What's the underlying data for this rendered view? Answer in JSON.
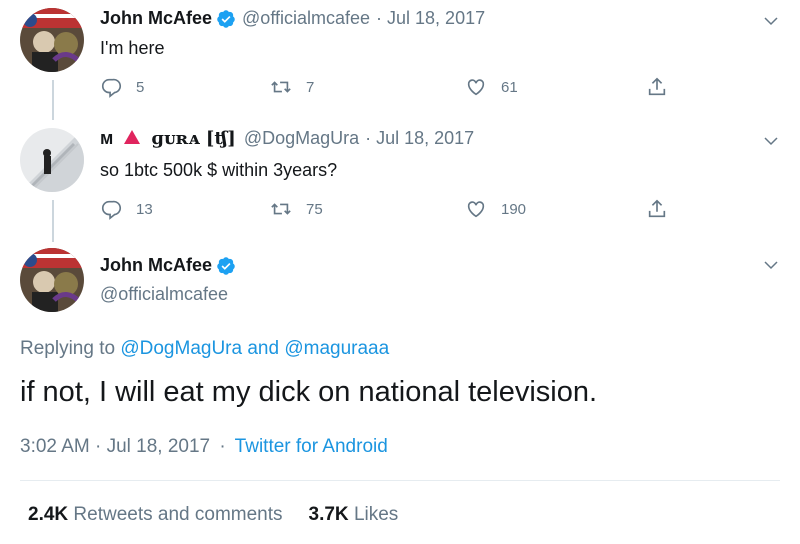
{
  "colors": {
    "text": "#14171a",
    "muted": "#657786",
    "link": "#1b95e0",
    "verified": "#1da1f2",
    "thread_line": "#ccd6dd"
  },
  "tweets": [
    {
      "name": "John McAfee",
      "verified": true,
      "handle": "@officialmcafee",
      "date": "· Jul 18, 2017",
      "text": "I'm here",
      "replies": "5",
      "retweets": "7",
      "likes": "61"
    },
    {
      "name_prefix": "ᴍ",
      "name_rest": "ɡᴜʀᴀ [ʧ]",
      "handle": "@DogMagUra",
      "date": "· Jul 18, 2017",
      "text": "so 1btc 500k $ within 3years?",
      "replies": "13",
      "retweets": "75",
      "likes": "190"
    }
  ],
  "main_tweet": {
    "name": "John McAfee",
    "handle": "@officialmcafee",
    "replying_prefix": "Replying to",
    "replying_user1": "@DogMagUra",
    "replying_and": "and",
    "replying_user2": "@maguraaa",
    "text": "if not, I will eat my dick on national television.",
    "time": "3:02 AM · Jul 18, 2017",
    "separator": "·",
    "source": "Twitter for Android",
    "retweets_count": "2.4K",
    "retweets_label": "Retweets and comments",
    "likes_count": "3.7K",
    "likes_label": "Likes"
  }
}
